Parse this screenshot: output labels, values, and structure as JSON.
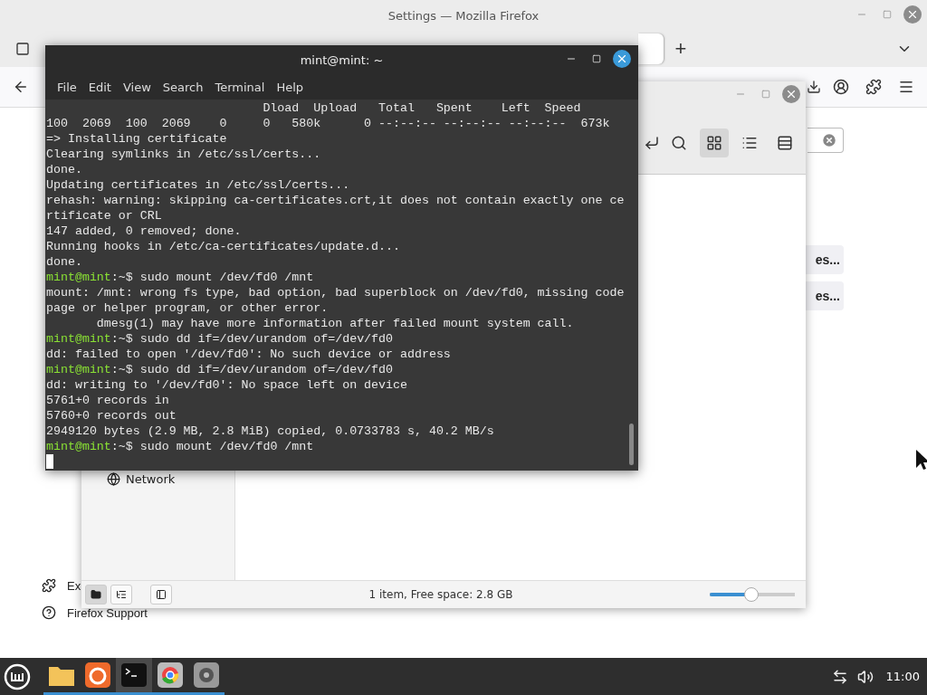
{
  "browser": {
    "title": "Settings — Mozilla Firefox",
    "new_tab": "+",
    "sidebar": [
      {
        "kind": "extensions",
        "label": "Ex"
      },
      {
        "kind": "support",
        "label": "Firefox Support"
      }
    ],
    "search": {
      "has_clear": true
    },
    "buttons": [
      "es...",
      "es..."
    ]
  },
  "file_manager": {
    "view_buttons": [
      {
        "kind": "icons",
        "selected": true
      },
      {
        "kind": "list",
        "selected": false
      },
      {
        "kind": "compact",
        "selected": false
      }
    ],
    "sidebar": [
      {
        "label": "Network"
      }
    ],
    "pane_buttons": [
      {
        "kind": "places",
        "selected": true
      },
      {
        "kind": "tree",
        "selected": false
      },
      {
        "kind": "toggle",
        "selected": false
      }
    ],
    "status": "1 item, Free space: 2.8 GB",
    "zoom": {
      "level": 0.48
    }
  },
  "terminal": {
    "title": "mint@mint: ~",
    "menu": [
      "File",
      "Edit",
      "View",
      "Search",
      "Terminal",
      "Help"
    ],
    "lines": [
      {
        "kind": "output",
        "text": "                              Dload  Upload   Total   Spent    Left  Speed"
      },
      {
        "kind": "output",
        "text": "100  2069  100  2069    0     0   580k      0 --:--:-- --:--:-- --:--:--  673k"
      },
      {
        "kind": "output",
        "text": "=> Installing certificate"
      },
      {
        "kind": "output",
        "text": "Clearing symlinks in /etc/ssl/certs..."
      },
      {
        "kind": "output",
        "text": "done."
      },
      {
        "kind": "output",
        "text": "Updating certificates in /etc/ssl/certs..."
      },
      {
        "kind": "output",
        "text": "rehash: warning: skipping ca-certificates.crt,it does not contain exactly one ce"
      },
      {
        "kind": "output",
        "text": "rtificate or CRL"
      },
      {
        "kind": "output",
        "text": "147 added, 0 removed; done."
      },
      {
        "kind": "output",
        "text": "Running hooks in /etc/ca-certificates/update.d..."
      },
      {
        "kind": "output",
        "text": "done."
      },
      {
        "kind": "prompt",
        "user": "mint@mint",
        "text": ":~$ sudo mount /dev/fd0 /mnt"
      },
      {
        "kind": "output",
        "text": "mount: /mnt: wrong fs type, bad option, bad superblock on /dev/fd0, missing code"
      },
      {
        "kind": "output",
        "text": "page or helper program, or other error."
      },
      {
        "kind": "output",
        "text": "       dmesg(1) may have more information after failed mount system call."
      },
      {
        "kind": "prompt",
        "user": "mint@mint",
        "text": ":~$ sudo dd if=/dev/urandom of=/dev/fd0"
      },
      {
        "kind": "output",
        "text": "dd: failed to open '/dev/fd0': No such device or address"
      },
      {
        "kind": "prompt",
        "user": "mint@mint",
        "text": ":~$ sudo dd if=/dev/urandom of=/dev/fd0"
      },
      {
        "kind": "output",
        "text": "dd: writing to '/dev/fd0': No space left on device"
      },
      {
        "kind": "output",
        "text": "5761+0 records in"
      },
      {
        "kind": "output",
        "text": "5760+0 records out"
      },
      {
        "kind": "output",
        "text": "2949120 bytes (2.9 MB, 2.8 MiB) copied, 0.0733783 s, 40.2 MB/s"
      },
      {
        "kind": "prompt",
        "user": "mint@mint",
        "text": ":~$ sudo mount /dev/fd0 /mnt"
      }
    ]
  },
  "taskbar": {
    "apps": [
      {
        "kind": "files",
        "active": false
      },
      {
        "kind": "firefox",
        "active": false
      },
      {
        "kind": "terminal",
        "active": true
      },
      {
        "kind": "chrome",
        "active": false
      },
      {
        "kind": "disks",
        "active": false
      }
    ],
    "clock": "11:00"
  }
}
